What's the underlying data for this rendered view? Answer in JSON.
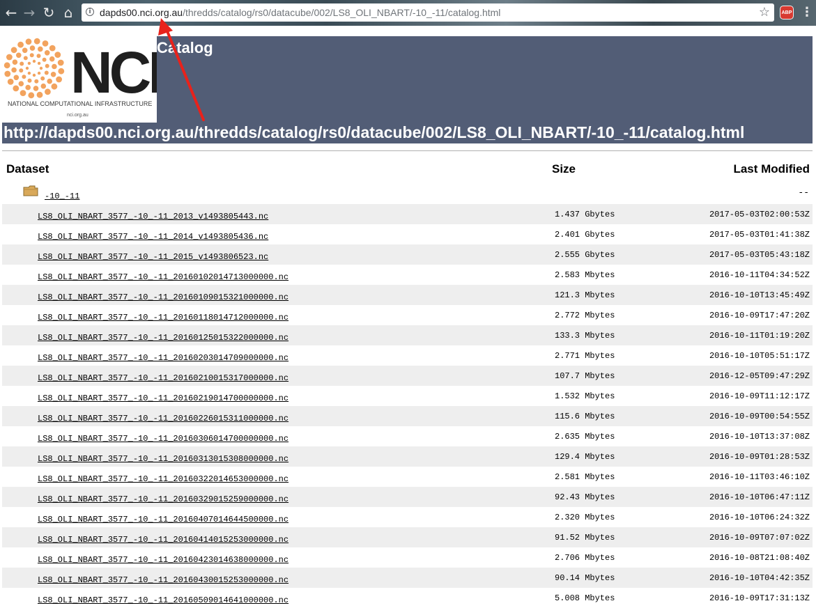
{
  "browser": {
    "url_host": "dapds00.nci.org.au",
    "url_path": "/thredds/catalog/rs0/datacube/002/LS8_OLI_NBART/-10_-11/catalog.html",
    "extension_badge": "ABP"
  },
  "logo": {
    "brand": "NCI",
    "tagline": "NATIONAL COMPUTATIONAL INFRASTRUCTURE",
    "site": "nci.org.au"
  },
  "header": {
    "title": "Catalog",
    "catalog_url": "http://dapds00.nci.org.au/thredds/catalog/rs0/datacube/002/LS8_OLI_NBART/-10_-11/catalog.html"
  },
  "table": {
    "columns": {
      "dataset": "Dataset",
      "size": "Size",
      "modified": "Last Modified"
    },
    "folder": {
      "name": "-10_-11",
      "modified": "--"
    },
    "rows": [
      {
        "name": "LS8_OLI_NBART_3577_-10_-11_2013_v1493805443.nc",
        "size": "1.437 Gbytes",
        "modified": "2017-05-03T02:00:53Z"
      },
      {
        "name": "LS8_OLI_NBART_3577_-10_-11_2014_v1493805436.nc",
        "size": "2.401 Gbytes",
        "modified": "2017-05-03T01:41:38Z"
      },
      {
        "name": "LS8_OLI_NBART_3577_-10_-11_2015_v1493806523.nc",
        "size": "2.555 Gbytes",
        "modified": "2017-05-03T05:43:18Z"
      },
      {
        "name": "LS8_OLI_NBART_3577_-10_-11_20160102014713000000.nc",
        "size": "2.583 Mbytes",
        "modified": "2016-10-11T04:34:52Z"
      },
      {
        "name": "LS8_OLI_NBART_3577_-10_-11_20160109015321000000.nc",
        "size": "121.3 Mbytes",
        "modified": "2016-10-10T13:45:49Z"
      },
      {
        "name": "LS8_OLI_NBART_3577_-10_-11_20160118014712000000.nc",
        "size": "2.772 Mbytes",
        "modified": "2016-10-09T17:47:20Z"
      },
      {
        "name": "LS8_OLI_NBART_3577_-10_-11_20160125015322000000.nc",
        "size": "133.3 Mbytes",
        "modified": "2016-10-11T01:19:20Z"
      },
      {
        "name": "LS8_OLI_NBART_3577_-10_-11_20160203014709000000.nc",
        "size": "2.771 Mbytes",
        "modified": "2016-10-10T05:51:17Z"
      },
      {
        "name": "LS8_OLI_NBART_3577_-10_-11_20160210015317000000.nc",
        "size": "107.7 Mbytes",
        "modified": "2016-12-05T09:47:29Z"
      },
      {
        "name": "LS8_OLI_NBART_3577_-10_-11_20160219014700000000.nc",
        "size": "1.532 Mbytes",
        "modified": "2016-10-09T11:12:17Z"
      },
      {
        "name": "LS8_OLI_NBART_3577_-10_-11_20160226015311000000.nc",
        "size": "115.6 Mbytes",
        "modified": "2016-10-09T00:54:55Z"
      },
      {
        "name": "LS8_OLI_NBART_3577_-10_-11_20160306014700000000.nc",
        "size": "2.635 Mbytes",
        "modified": "2016-10-10T13:37:08Z"
      },
      {
        "name": "LS8_OLI_NBART_3577_-10_-11_20160313015308000000.nc",
        "size": "129.4 Mbytes",
        "modified": "2016-10-09T01:28:53Z"
      },
      {
        "name": "LS8_OLI_NBART_3577_-10_-11_20160322014653000000.nc",
        "size": "2.581 Mbytes",
        "modified": "2016-10-11T03:46:10Z"
      },
      {
        "name": "LS8_OLI_NBART_3577_-10_-11_20160329015259000000.nc",
        "size": "92.43 Mbytes",
        "modified": "2016-10-10T06:47:11Z"
      },
      {
        "name": "LS8_OLI_NBART_3577_-10_-11_20160407014644500000.nc",
        "size": "2.320 Mbytes",
        "modified": "2016-10-10T06:24:32Z"
      },
      {
        "name": "LS8_OLI_NBART_3577_-10_-11_20160414015253000000.nc",
        "size": "91.52 Mbytes",
        "modified": "2016-10-09T07:07:02Z"
      },
      {
        "name": "LS8_OLI_NBART_3577_-10_-11_20160423014638000000.nc",
        "size": "2.706 Mbytes",
        "modified": "2016-10-08T21:08:40Z"
      },
      {
        "name": "LS8_OLI_NBART_3577_-10_-11_20160430015253000000.nc",
        "size": "90.14 Mbytes",
        "modified": "2016-10-10T04:42:35Z"
      },
      {
        "name": "LS8_OLI_NBART_3577_-10_-11_20160509014641000000.nc",
        "size": "5.008 Mbytes",
        "modified": "2016-10-09T17:31:13Z"
      }
    ]
  },
  "colors": {
    "banner": "#525d76",
    "row_alt": "#eeeeee",
    "annotation_arrow": "#e8221b",
    "logo_accent": "#f2a35e"
  }
}
